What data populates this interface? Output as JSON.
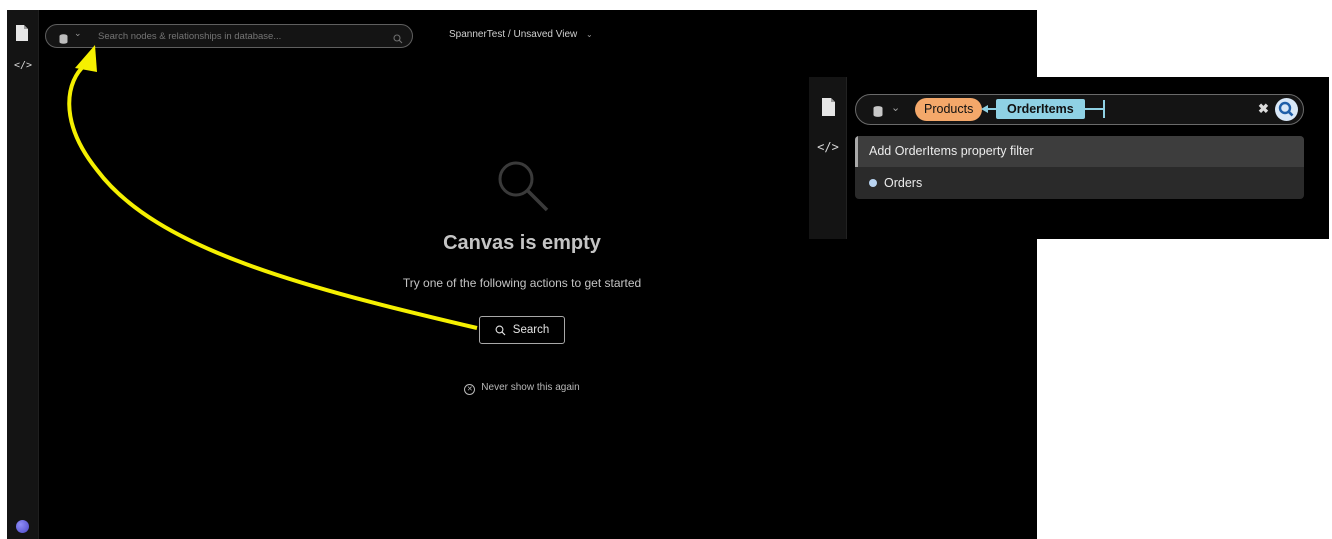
{
  "main": {
    "search": {
      "placeholder": "Search nodes & relationships in database...",
      "icons": {
        "database": "database-icon",
        "chevron": "chevron-down-icon",
        "search": "search-icon"
      }
    },
    "view_title": "SpannerTest / Unsaved View",
    "empty_state": {
      "title": "Canvas is empty",
      "subtitle": "Try one of the following actions to get started",
      "search_button": "Search",
      "never_show": "Never show this again"
    }
  },
  "inset": {
    "pill_start": "Products",
    "pill_relationship": "OrderItems",
    "dropdown": {
      "items": [
        {
          "label": "Add OrderItems property filter"
        },
        {
          "label": "Orders"
        }
      ]
    }
  },
  "colors": {
    "background": "#000000",
    "sidebar": "#141414",
    "node_pill": "#f4a86a",
    "relationship_pill": "#8fd1e4",
    "arrow_annotation": "#f5f000",
    "suggestion_dot": "#b9d4f1"
  }
}
